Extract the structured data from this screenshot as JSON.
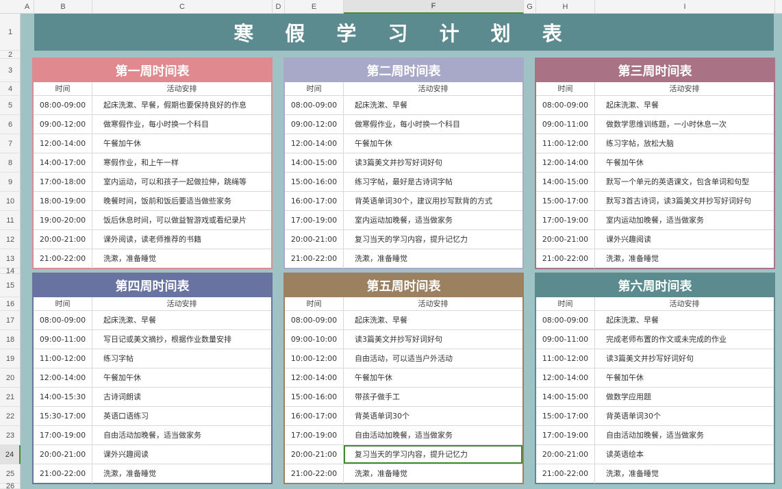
{
  "spreadsheet": {
    "columns": [
      "A",
      "B",
      "C",
      "D",
      "E",
      "F",
      "G",
      "H",
      "I"
    ],
    "active_column": "F",
    "rows": [
      "1",
      "2",
      "3",
      "4",
      "5",
      "6",
      "7",
      "8",
      "9",
      "10",
      "11",
      "12",
      "13",
      "14",
      "15",
      "16",
      "17",
      "18",
      "19",
      "20",
      "21",
      "22",
      "23",
      "24",
      "25",
      "26"
    ],
    "active_row": "24"
  },
  "title": "寒 假 学 习 计 划 表",
  "colors": {
    "sheet_bg": "#9fc3c4",
    "title_bg": "#5b8b8f",
    "week1": "#e08a8f",
    "week2": "#a8a8c8",
    "week3": "#a97385",
    "week4": "#6873a2",
    "week5": "#9c8160",
    "week6": "#5b8b8f"
  },
  "weeks": [
    {
      "title": "第一周时间表",
      "col_time": "时间",
      "col_activity": "活动安排",
      "rows": [
        {
          "time": "08:00-09:00",
          "activity": "起床洗漱、早餐，假期也要保持良好的作息"
        },
        {
          "time": "09:00-12:00",
          "activity": "做寒假作业，每小时换一个科目"
        },
        {
          "time": "12:00-14:00",
          "activity": "午餐加午休"
        },
        {
          "time": "14:00-17:00",
          "activity": "寒假作业，和上午一样"
        },
        {
          "time": "17:00-18:00",
          "activity": "室内运动，可以和孩子一起做拉伸，跳绳等"
        },
        {
          "time": "18:00-19:00",
          "activity": "晚餐时间，饭前和饭后要适当做些家务"
        },
        {
          "time": "19:00-20:00",
          "activity": "饭后休息时间，可以做益智游戏或看纪录片"
        },
        {
          "time": "20:00-21:00",
          "activity": "课外阅读，读老师推荐的书籍"
        },
        {
          "time": "21:00-22:00",
          "activity": "洗漱，准备睡觉"
        }
      ]
    },
    {
      "title": "第二周时间表",
      "col_time": "时间",
      "col_activity": "活动安排",
      "rows": [
        {
          "time": "08:00-09:00",
          "activity": "起床洗漱、早餐"
        },
        {
          "time": "09:00-12:00",
          "activity": "做寒假作业，每小时换一个科目"
        },
        {
          "time": "12:00-14:00",
          "activity": "午餐加午休"
        },
        {
          "time": "14:00-15:00",
          "activity": "读3篇美文并抄写好词好句"
        },
        {
          "time": "15:00-16:00",
          "activity": "练习字帖，最好是古诗词字帖"
        },
        {
          "time": "16:00-17:00",
          "activity": "背英语单词30个，建议用抄写默背的方式"
        },
        {
          "time": "17:00-19:00",
          "activity": "室内运动加晚餐，适当做家务"
        },
        {
          "time": "20:00-21:00",
          "activity": "复习当天的学习内容，提升记忆力"
        },
        {
          "time": "21:00-22:00",
          "activity": "洗漱，准备睡觉"
        }
      ]
    },
    {
      "title": "第三周时间表",
      "col_time": "时间",
      "col_activity": "活动安排",
      "rows": [
        {
          "time": "08:00-09:00",
          "activity": "起床洗漱、早餐"
        },
        {
          "time": "09:00-11:00",
          "activity": "做数学思维训练题，一小时休息一次"
        },
        {
          "time": "11:00-12:00",
          "activity": "练习字帖，放松大脑"
        },
        {
          "time": "12:00-14:00",
          "activity": "午餐加午休"
        },
        {
          "time": "14:00-15:00",
          "activity": "默写一个单元的英语课文，包含单词和句型"
        },
        {
          "time": "15:00-17:00",
          "activity": "默写3首古诗词，读3篇美文并抄写好词好句"
        },
        {
          "time": "17:00-19:00",
          "activity": "室内运动加晚餐，适当做家务"
        },
        {
          "time": "20:00-21:00",
          "activity": "课外兴趣阅读"
        },
        {
          "time": "21:00-22:00",
          "activity": "洗漱，准备睡觉"
        }
      ]
    },
    {
      "title": "第四周时间表",
      "col_time": "时间",
      "col_activity": "活动安排",
      "rows": [
        {
          "time": "08:00-09:00",
          "activity": "起床洗漱、早餐"
        },
        {
          "time": "09:00-11:00",
          "activity": "写日记或美文摘抄，根据作业数量安排"
        },
        {
          "time": "11:00-12:00",
          "activity": "练习字帖"
        },
        {
          "time": "12:00-14:00",
          "activity": "午餐加午休"
        },
        {
          "time": "14:00-15:30",
          "activity": "古诗词朗读"
        },
        {
          "time": "15:30-17:00",
          "activity": "英语口语练习"
        },
        {
          "time": "17:00-19:00",
          "activity": "自由活动加晚餐，适当做家务"
        },
        {
          "time": "20:00-21:00",
          "activity": "课外兴趣阅读"
        },
        {
          "time": "21:00-22:00",
          "activity": "洗漱，准备睡觉"
        }
      ]
    },
    {
      "title": "第五周时间表",
      "col_time": "时间",
      "col_activity": "活动安排",
      "rows": [
        {
          "time": "08:00-09:00",
          "activity": "起床洗漱、早餐"
        },
        {
          "time": "09:00-10:00",
          "activity": "读3篇美文并抄写好词好句"
        },
        {
          "time": "10:00-12:00",
          "activity": "自由活动，可以适当户外活动"
        },
        {
          "time": "12:00-14:00",
          "activity": "午餐加午休"
        },
        {
          "time": "15:00-16:00",
          "activity": "带孩子做手工"
        },
        {
          "time": "16:00-17:00",
          "activity": "背英语单词30个"
        },
        {
          "time": "17:00-19:00",
          "activity": "自由活动加晚餐，适当做家务"
        },
        {
          "time": "20:00-21:00",
          "activity": "复习当天的学习内容，提升记忆力"
        },
        {
          "time": "21:00-22:00",
          "activity": "洗漱，准备睡觉"
        }
      ]
    },
    {
      "title": "第六周时间表",
      "col_time": "时间",
      "col_activity": "活动安排",
      "rows": [
        {
          "time": "08:00-09:00",
          "activity": "起床洗漱、早餐"
        },
        {
          "time": "09:00-11:00",
          "activity": "完成老师布置的作文或未完成的作业"
        },
        {
          "time": "11:00-12:00",
          "activity": "读3篇美文并抄写好词好句"
        },
        {
          "time": "12:00-14:00",
          "activity": "午餐加午休"
        },
        {
          "time": "14:00-15:00",
          "activity": "做数学应用题"
        },
        {
          "time": "15:00-17:00",
          "activity": "背英语单词30个"
        },
        {
          "time": "17:00-19:00",
          "activity": "自由活动加晚餐，适当做家务"
        },
        {
          "time": "20:00-21:00",
          "activity": "读英语绘本"
        },
        {
          "time": "21:00-22:00",
          "activity": "洗漱，准备睡觉"
        }
      ]
    }
  ]
}
